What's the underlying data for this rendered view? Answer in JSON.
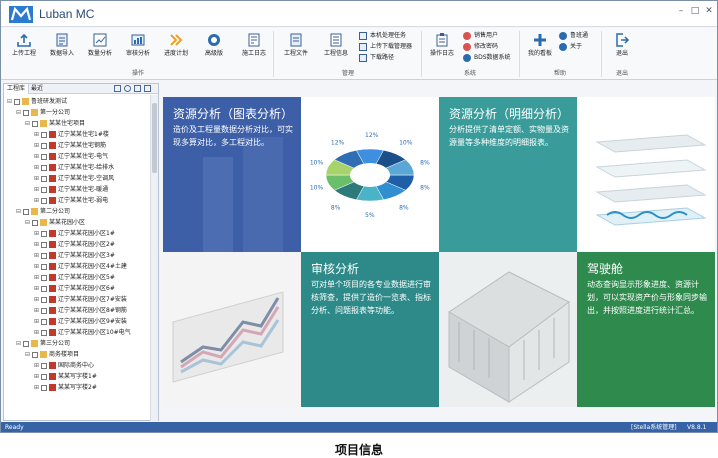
{
  "app": {
    "logo_text": "M",
    "title": "Luban MC"
  },
  "window_controls": {
    "minimize": "–",
    "maximize": "□",
    "close": "✕"
  },
  "ribbon": {
    "buttons": [
      {
        "label": "上传工程",
        "icon": "upload-icon"
      },
      {
        "label": "数据导入",
        "icon": "import-icon"
      },
      {
        "label": "数量分析",
        "icon": "chart-icon"
      },
      {
        "label": "审核分析",
        "icon": "audit-icon"
      },
      {
        "label": "进度计划",
        "icon": "chevron-double-icon"
      },
      {
        "label": "高级版",
        "icon": "circle-icon"
      },
      {
        "label": "施工日志",
        "icon": "log-icon"
      },
      {
        "label": "工程文件",
        "icon": "file-icon"
      },
      {
        "label": "工程信息",
        "icon": "info-icon"
      },
      {
        "label": "操作日志",
        "icon": "clipboard-icon"
      },
      {
        "label": "我的看板",
        "icon": "board-icon"
      },
      {
        "label": "退出",
        "icon": "exit-icon"
      }
    ],
    "small_buttons": [
      "本机处理任务",
      "上传下载管理器",
      "下载路径",
      "销售用户",
      "修改密码",
      "BDS数据系统",
      "鲁班通",
      "关于"
    ],
    "groups": [
      "操作",
      "管理",
      "系统",
      "帮助",
      "退出"
    ]
  },
  "left_panel": {
    "tabs": [
      "工程库",
      "最近"
    ],
    "tree": [
      {
        "level": 0,
        "label": "鲁班研发测试"
      },
      {
        "level": 1,
        "label": "第一分公司"
      },
      {
        "level": 2,
        "label": "某某住宅项目"
      },
      {
        "level": 3,
        "label": "辽宁某某住宅1#楼"
      },
      {
        "level": 3,
        "label": "辽宁某某住宅钢筋"
      },
      {
        "level": 3,
        "label": "辽宁某某住宅-电气"
      },
      {
        "level": 3,
        "label": "辽宁某某住宅-给排水"
      },
      {
        "level": 3,
        "label": "辽宁某某住宅-空调风"
      },
      {
        "level": 3,
        "label": "辽宁某某住宅-暖通"
      },
      {
        "level": 3,
        "label": "辽宁某某住宅-弱电"
      },
      {
        "level": 1,
        "label": "第二分公司"
      },
      {
        "level": 2,
        "label": "某某花园小区"
      },
      {
        "level": 3,
        "label": "辽宁某某花园小区1#"
      },
      {
        "level": 3,
        "label": "辽宁某某花园小区2#"
      },
      {
        "level": 3,
        "label": "辽宁某某花园小区3#"
      },
      {
        "level": 3,
        "label": "辽宁某某花园小区4#土建"
      },
      {
        "level": 3,
        "label": "辽宁某某花园小区5#"
      },
      {
        "level": 3,
        "label": "辽宁某某花园小区6#"
      },
      {
        "level": 3,
        "label": "辽宁某某花园小区7#安装"
      },
      {
        "level": 3,
        "label": "辽宁某某花园小区8#钢筋"
      },
      {
        "level": 3,
        "label": "辽宁某某花园小区9#安装"
      },
      {
        "level": 3,
        "label": "辽宁某某花园小区10#电气"
      },
      {
        "level": 1,
        "label": "第三分公司"
      },
      {
        "level": 2,
        "label": "商务楼项目"
      },
      {
        "level": 3,
        "label": "国际商务中心"
      },
      {
        "level": 3,
        "label": "某某写字楼1#"
      },
      {
        "level": 3,
        "label": "某某写字楼2#"
      }
    ]
  },
  "tiles": [
    {
      "title": "资源分析（图表分析）",
      "desc": "造价及工程量数据分析对比，可实现多算对比，多工程对比。"
    },
    {
      "title": "资源分析（明细分析）",
      "desc": "分析提供了清单定额、实物量及资源量等多种维度的明细报表。"
    },
    {
      "title": "审核分析",
      "desc": "可对单个项目的各专业数据进行审核筛查，提供了造价一览表、指标分析、问题报表等功能。"
    },
    {
      "title": "驾驶舱",
      "desc": "动态查询显示形象进度、资源计划，可以实现资产价与形象同步输出，并按照进度进行统计汇总。"
    }
  ],
  "donut_labels": [
    "8%",
    "8%",
    "5%",
    "8%",
    "10%",
    "10%",
    "12%",
    "12%",
    "10%",
    "8%"
  ],
  "status": {
    "left": "Ready",
    "mid": "[Stella系统管理]",
    "version": "V8.8.1"
  },
  "caption": "项目信息"
}
